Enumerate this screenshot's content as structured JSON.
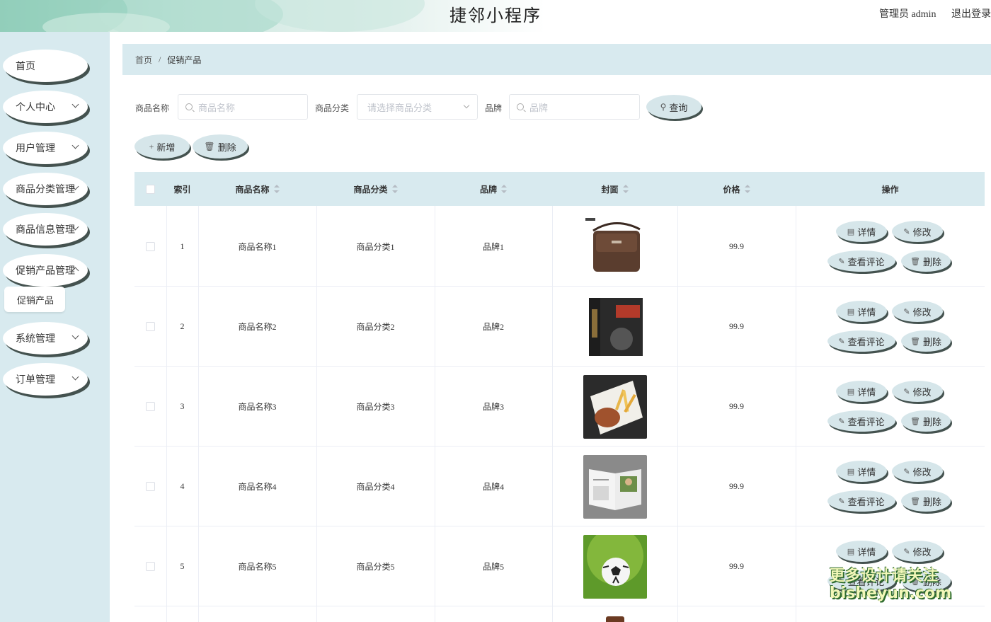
{
  "header": {
    "title": "捷邻小程序",
    "user_label": "管理员 admin",
    "logout_label": "退出登录"
  },
  "sidebar": {
    "items": [
      {
        "label": "首页",
        "has_arrow": false
      },
      {
        "label": "个人中心",
        "has_arrow": true
      },
      {
        "label": "用户管理",
        "has_arrow": true
      },
      {
        "label": "商品分类管理",
        "has_arrow": true
      },
      {
        "label": "商品信息管理",
        "has_arrow": true
      },
      {
        "label": "促销产品管理",
        "has_arrow": true
      },
      {
        "label": "系统管理",
        "has_arrow": true
      },
      {
        "label": "订单管理",
        "has_arrow": true
      }
    ],
    "submenu": {
      "label": "促销产品"
    }
  },
  "breadcrumb": {
    "home": "首页",
    "separator": "/",
    "current": "促销产品"
  },
  "search": {
    "name_label": "商品名称",
    "name_placeholder": "商品名称",
    "category_label": "商品分类",
    "category_placeholder": "请选择商品分类",
    "brand_label": "品牌",
    "brand_placeholder": "品牌",
    "query_button": "查询"
  },
  "toolbar": {
    "add_label": "新增",
    "delete_label": "删除"
  },
  "table": {
    "columns": [
      "索引",
      "商品名称",
      "商品分类",
      "品牌",
      "封面",
      "价格",
      "操作"
    ],
    "rows": [
      {
        "index": "1",
        "name": "商品名称1",
        "category": "商品分类1",
        "brand": "品牌1",
        "cover": "leather-bag-image",
        "price": "99.9"
      },
      {
        "index": "2",
        "name": "商品名称2",
        "category": "商品分类2",
        "brand": "品牌2",
        "cover": "book-set-image",
        "price": "99.9"
      },
      {
        "index": "3",
        "name": "商品名称3",
        "category": "商品分类3",
        "brand": "品牌3",
        "cover": "burger-fries-image",
        "price": "99.9"
      },
      {
        "index": "4",
        "name": "商品名称4",
        "category": "商品分类4",
        "brand": "品牌4",
        "cover": "open-magazine-image",
        "price": "99.9"
      },
      {
        "index": "5",
        "name": "商品名称5",
        "category": "商品分类5",
        "brand": "品牌5",
        "cover": "soccer-ball-image",
        "price": "99.9"
      }
    ],
    "actions": {
      "detail": "详情",
      "edit": "修改",
      "comments": "查看评论",
      "delete": "删除"
    }
  },
  "watermark": {
    "line1": "更多设计请关注",
    "line2": "bisheyun.com"
  },
  "colors": {
    "accent": "#d8eaef",
    "button": "#d6e6ea",
    "shadow": "#44524f"
  }
}
